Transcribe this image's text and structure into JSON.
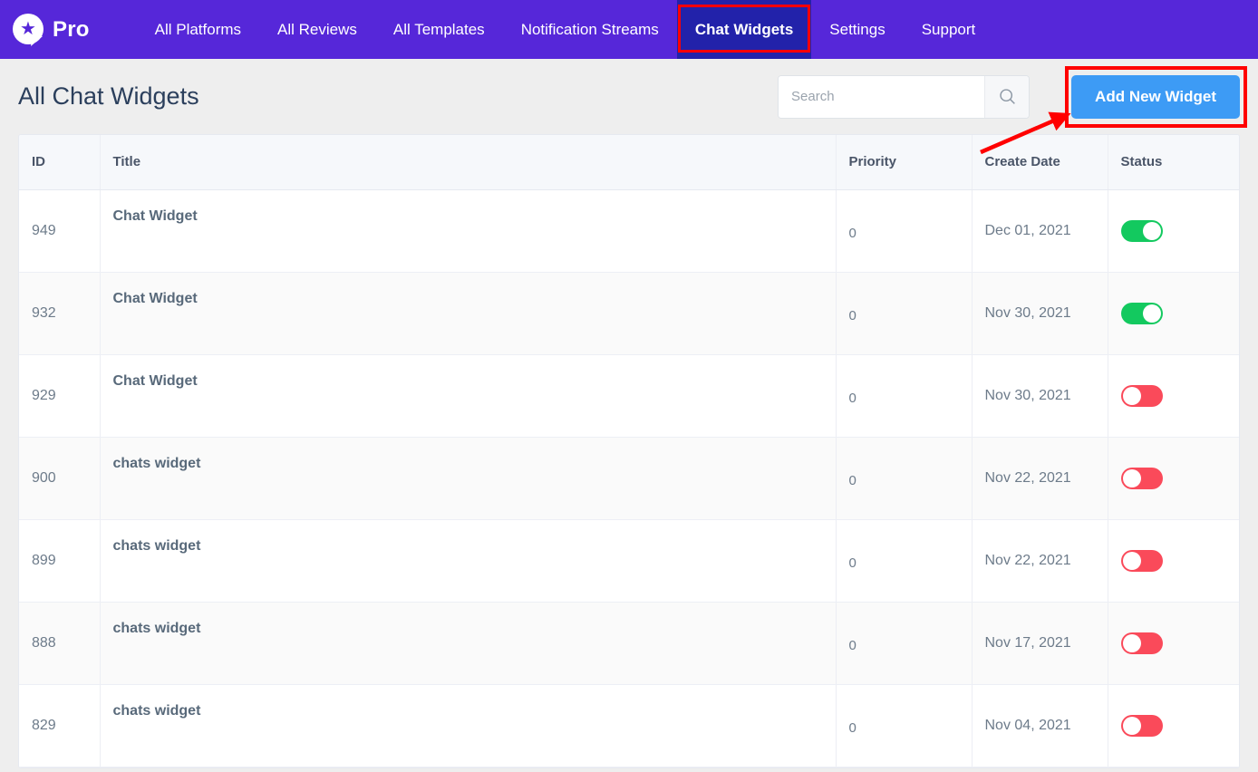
{
  "topbar": {
    "brand": "Pro",
    "logo_icon": "star-speech-bubble-icon",
    "nav_items": [
      {
        "label": "All Platforms",
        "active": false
      },
      {
        "label": "All Reviews",
        "active": false
      },
      {
        "label": "All Templates",
        "active": false
      },
      {
        "label": "Notification Streams",
        "active": false
      },
      {
        "label": "Chat Widgets",
        "active": true
      },
      {
        "label": "Settings",
        "active": false
      },
      {
        "label": "Support",
        "active": false
      }
    ],
    "background_color": "#5627d9",
    "active_tab_color": "#2222aa"
  },
  "page": {
    "title": "All Chat Widgets"
  },
  "search": {
    "placeholder": "Search",
    "value": "",
    "icon": "magnifier-icon"
  },
  "add_button": {
    "label": "Add New Widget",
    "color": "#3d9bf5"
  },
  "annotations": {
    "highlight_color": "#ff0000",
    "arrow_target": "add-new-widget-button"
  },
  "table": {
    "columns": [
      "ID",
      "Title",
      "Priority",
      "Create Date",
      "Status"
    ],
    "rows": [
      {
        "id": "949",
        "title": "Chat Widget",
        "priority": "0",
        "date": "Dec 01, 2021",
        "status": "on"
      },
      {
        "id": "932",
        "title": "Chat Widget",
        "priority": "0",
        "date": "Nov 30, 2021",
        "status": "on"
      },
      {
        "id": "929",
        "title": "Chat Widget",
        "priority": "0",
        "date": "Nov 30, 2021",
        "status": "off"
      },
      {
        "id": "900",
        "title": "chats widget",
        "priority": "0",
        "date": "Nov 22, 2021",
        "status": "off"
      },
      {
        "id": "899",
        "title": "chats widget",
        "priority": "0",
        "date": "Nov 22, 2021",
        "status": "off"
      },
      {
        "id": "888",
        "title": "chats widget",
        "priority": "0",
        "date": "Nov 17, 2021",
        "status": "off"
      },
      {
        "id": "829",
        "title": "chats widget",
        "priority": "0",
        "date": "Nov 04, 2021",
        "status": "off"
      }
    ],
    "toggle_on_color": "#13c95f",
    "toggle_off_color": "#fa4a5a"
  }
}
